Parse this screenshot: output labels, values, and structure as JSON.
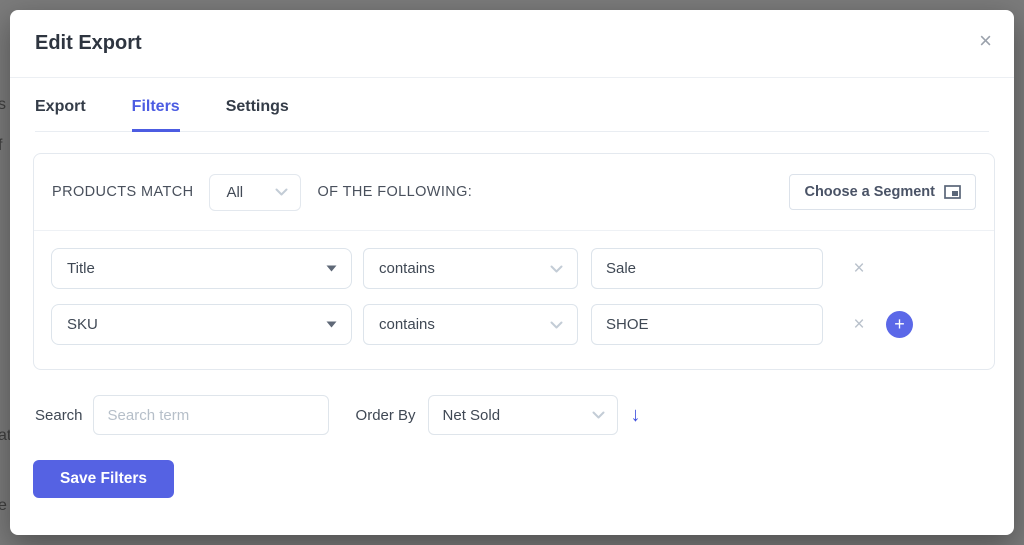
{
  "overlay": {
    "background_fragments": [
      "s",
      "f",
      "at",
      "e"
    ]
  },
  "modal": {
    "title": "Edit Export",
    "close_icon": "×"
  },
  "tabs": [
    {
      "label": "Export"
    },
    {
      "label": "Filters"
    },
    {
      "label": "Settings"
    }
  ],
  "active_tab": "Filters",
  "filter_panel": {
    "match_label": "PRODUCTS MATCH",
    "match_value": "All",
    "following_label": "OF THE FOLLOWING:",
    "segment_button_label": "Choose a Segment",
    "rows": [
      {
        "field": "Title",
        "operator": "contains",
        "value": "Sale",
        "remove_icon": "×"
      },
      {
        "field": "SKU",
        "operator": "contains",
        "value": "SHOE",
        "remove_icon": "×"
      }
    ],
    "add_icon": "+"
  },
  "search": {
    "label": "Search",
    "placeholder": "Search term",
    "value": ""
  },
  "order_by": {
    "label": "Order By",
    "value": "Net Sold",
    "direction_icon": "↓"
  },
  "save_button_label": "Save Filters",
  "colors": {
    "accent": "#4c5ce2",
    "add_button": "#5b68e8",
    "save_button": "#5562e3",
    "overlay": "#7b7b7b"
  }
}
